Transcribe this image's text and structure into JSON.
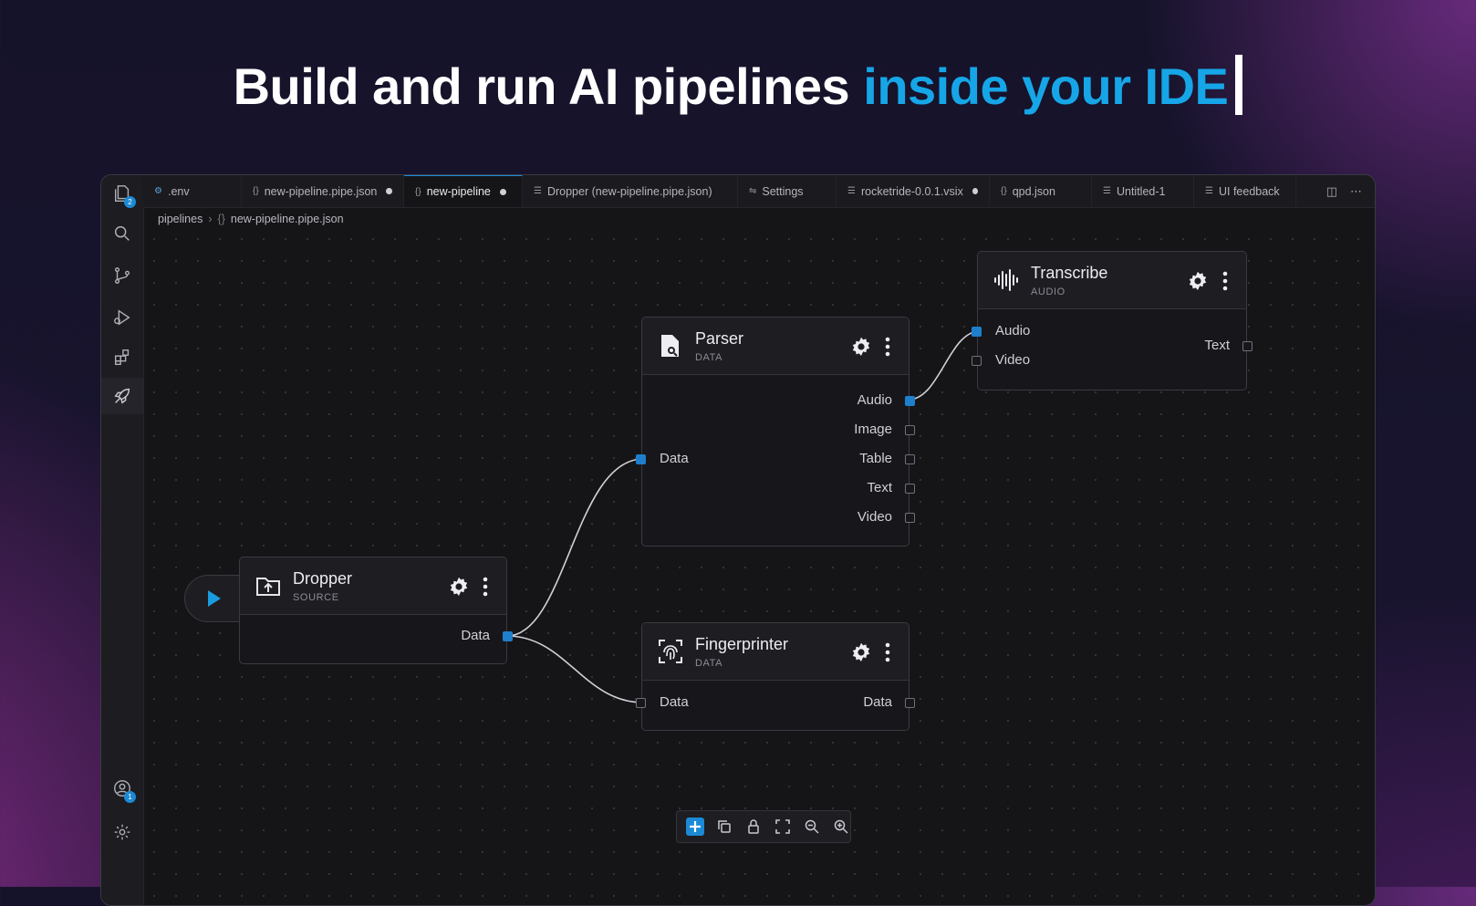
{
  "headline": {
    "text": "Build and run AI pipelines ",
    "accent": "inside your IDE"
  },
  "activity_bar": {
    "explorer_badge": "2",
    "accounts_badge": "1"
  },
  "tabs": [
    {
      "label": ".env",
      "icon": "gear-icon"
    },
    {
      "label": "new-pipeline.pipe.json",
      "icon": "braces-icon",
      "modified": true
    },
    {
      "label": "new-pipeline",
      "icon": "braces-icon",
      "modified": true,
      "active": true
    },
    {
      "label": "Dropper (new-pipeline.pipe.json)",
      "icon": "lines-icon"
    },
    {
      "label": "Settings",
      "icon": "sliders-icon"
    },
    {
      "label": "rocketride-0.0.1.vsix",
      "icon": "lines-icon",
      "modified": true
    },
    {
      "label": "qpd.json",
      "icon": "braces-icon"
    },
    {
      "label": "Untitled-1",
      "icon": "lines-icon"
    },
    {
      "label": "UI feedback",
      "icon": "lines-icon"
    }
  ],
  "breadcrumb": {
    "folder": "pipelines",
    "file": "new-pipeline.pipe.json"
  },
  "nodes": {
    "dropper": {
      "title": "Dropper",
      "subtitle": "SOURCE",
      "output": "Data"
    },
    "parser": {
      "title": "Parser",
      "subtitle": "DATA",
      "input": "Data",
      "outputs": [
        "Audio",
        "Image",
        "Table",
        "Text",
        "Video"
      ]
    },
    "transcribe": {
      "title": "Transcribe",
      "subtitle": "AUDIO",
      "inputs": [
        "Audio",
        "Video"
      ],
      "output": "Text"
    },
    "fingerprinter": {
      "title": "Fingerprinter",
      "subtitle": "DATA",
      "input": "Data",
      "output": "Data"
    }
  },
  "colors": {
    "accent": "#16a6e8",
    "port_active": "#1f7fcc",
    "background": "#151518"
  },
  "toolbar": [
    "add-icon",
    "copy-icon",
    "lock-icon",
    "fit-view-icon",
    "zoom-out-icon",
    "zoom-in-icon"
  ]
}
